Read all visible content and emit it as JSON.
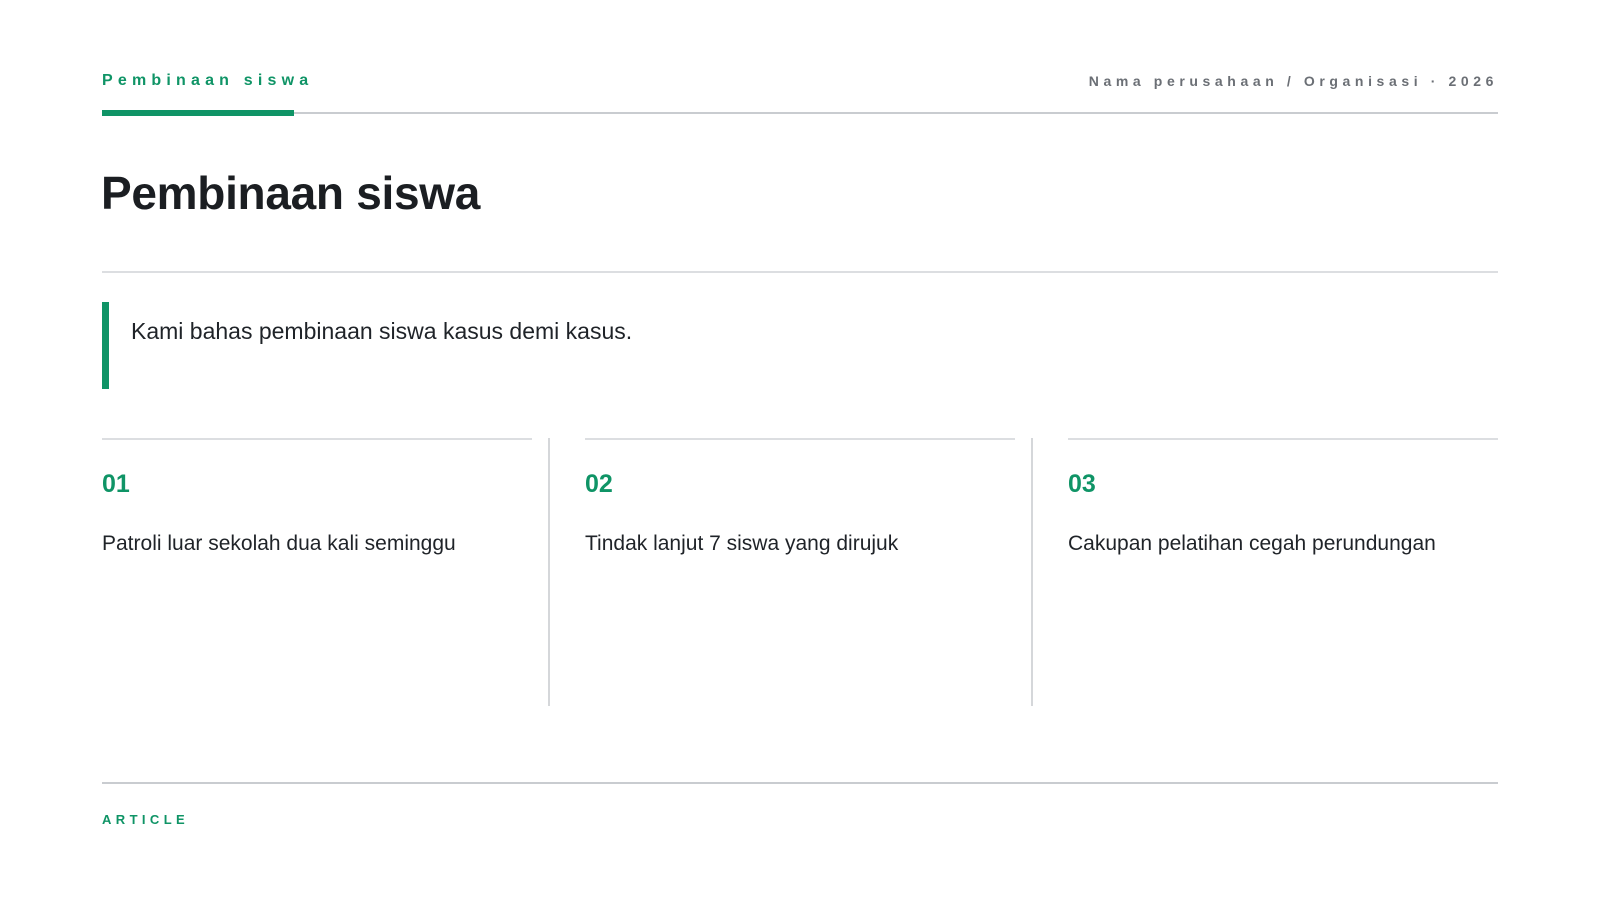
{
  "header": {
    "kicker": "Pembinaan siswa",
    "meta": "Nama perusahaan / Organisasi · 2026"
  },
  "title": "Pembinaan siswa",
  "quote": "Kami bahas pembinaan siswa kasus demi kasus.",
  "cards": [
    {
      "number": "01",
      "text": "Patroli luar sekolah dua kali seminggu"
    },
    {
      "number": "02",
      "text": "Tindak lanjut 7 siswa yang dirujuk"
    },
    {
      "number": "03",
      "text": "Cakupan pelatihan cegah perundungan"
    }
  ],
  "footer": {
    "label": "ARTICLE"
  },
  "colors": {
    "accent": "#0f9466",
    "text": "#1f2328",
    "muted": "#6b6f75",
    "rule": "#c9ccd0"
  }
}
